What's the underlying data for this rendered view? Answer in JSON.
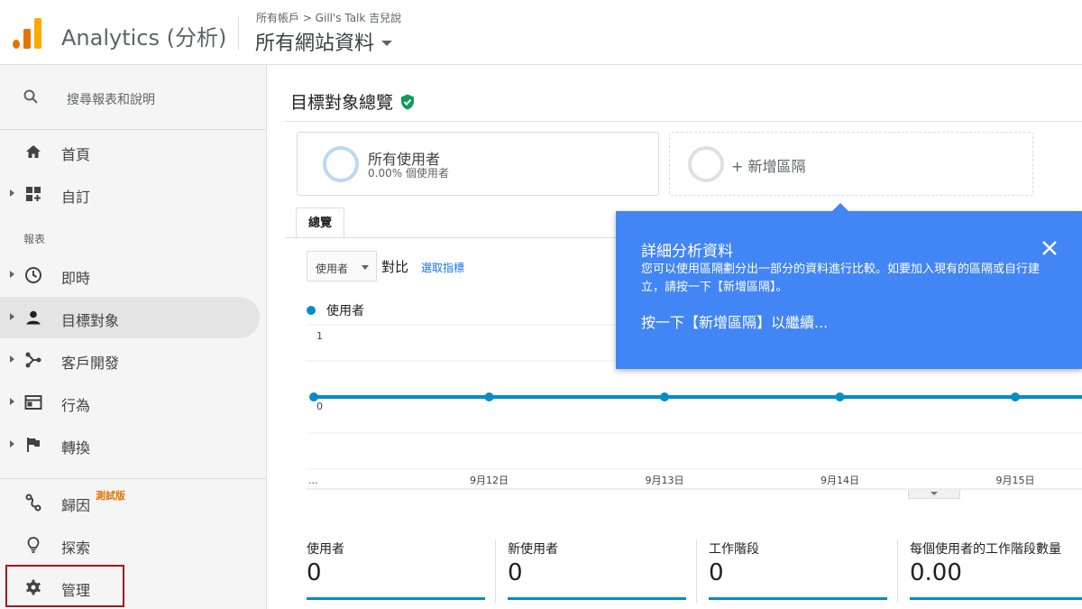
{
  "header": {
    "app_title": "Analytics (分析)",
    "breadcrumb": "所有帳戶 > Gill's Talk 吉兒說",
    "view_name": "所有網站資料"
  },
  "sidebar": {
    "search_placeholder": "搜尋報表和說明",
    "items_top": [
      {
        "label": "首頁",
        "icon": "home-icon"
      },
      {
        "label": "自訂",
        "icon": "customization-icon"
      }
    ],
    "section_label": "報表",
    "reports": [
      {
        "label": "即時",
        "icon": "clock-icon"
      },
      {
        "label": "目標對象",
        "icon": "person-icon",
        "active": true
      },
      {
        "label": "客戶開發",
        "icon": "acquisition-icon"
      },
      {
        "label": "行為",
        "icon": "behavior-icon"
      },
      {
        "label": "轉換",
        "icon": "flag-icon"
      }
    ],
    "bottom": [
      {
        "label": "歸因",
        "icon": "attribution-icon",
        "badge": "測試版"
      },
      {
        "label": "探索",
        "icon": "lightbulb-icon"
      },
      {
        "label": "管理",
        "icon": "gear-icon"
      }
    ]
  },
  "main": {
    "page_title": "目標對象總覽",
    "segments": {
      "primary_name": "所有使用者",
      "primary_sub": "0.00% 個使用者",
      "add_label": "+ 新增區隔"
    },
    "tab_label": "總覽",
    "metric_select": "使用者",
    "vs_label": "對比",
    "select_metric_link": "選取指標",
    "legend_label": "使用者",
    "summary": [
      {
        "name": "使用者",
        "value": "0"
      },
      {
        "name": "新使用者",
        "value": "0"
      },
      {
        "name": "工作階段",
        "value": "0"
      },
      {
        "name": "每個使用者的工作階段數量",
        "value": "0.00"
      }
    ]
  },
  "tooltip": {
    "title": "詳細分析資料",
    "body": "您可以使用區隔劃分出一部分的資料進行比較。如要加入現有的區隔或自行建立，請按一下【新增區隔】。",
    "action": "按一下【新增區隔】以繼續..."
  },
  "chart_data": {
    "type": "line",
    "series": [
      {
        "name": "使用者",
        "values": [
          0,
          0,
          0,
          0,
          0
        ]
      }
    ],
    "categories": [
      "...",
      "9月12日",
      "9月13日",
      "9月14日",
      "9月15日"
    ],
    "y_ticks": [
      "1",
      "0"
    ],
    "ylim": [
      0,
      1
    ],
    "colors": {
      "line": "#058dc7"
    }
  }
}
